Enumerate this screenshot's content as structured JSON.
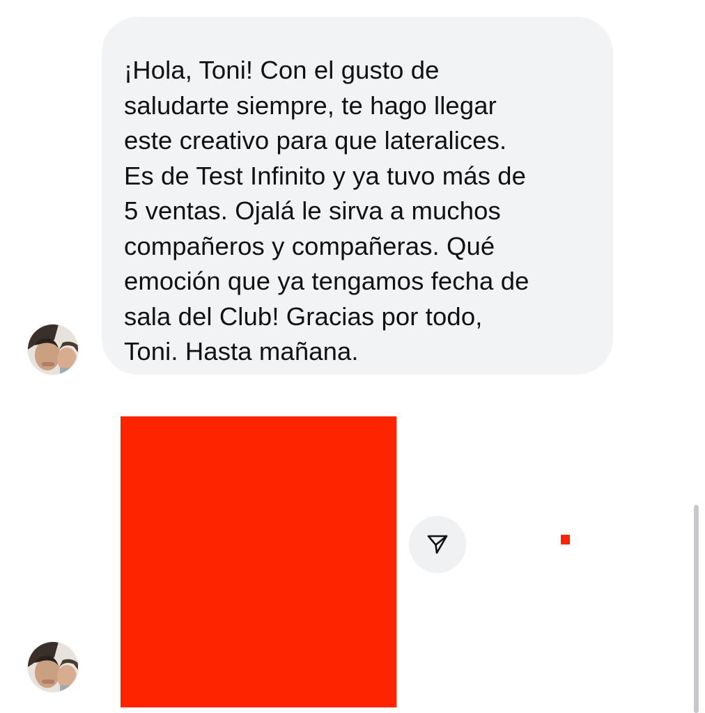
{
  "conversation": {
    "message_text": "¡Hola, Toni! Con el gusto de\nsaludarte siempre, te hago llegar\neste creativo para que lateralices.\nEs de Test Infinito y ya tuvo más de\n5 ventas. Ojalá le sirva a muchos\ncompañeros y compañeras. Qué\nemoción que ya tengamos fecha de\nsala del Club! Gracias por todo,\nToni. Hasta mañana.",
    "avatar_icon": "user-avatar-photo",
    "share_icon": "paper-plane-icon"
  },
  "colors": {
    "bubble_background": "#f2f3f5",
    "media_red": "#ff2400",
    "share_button_background": "#f0f1f3",
    "text": "#111111"
  }
}
